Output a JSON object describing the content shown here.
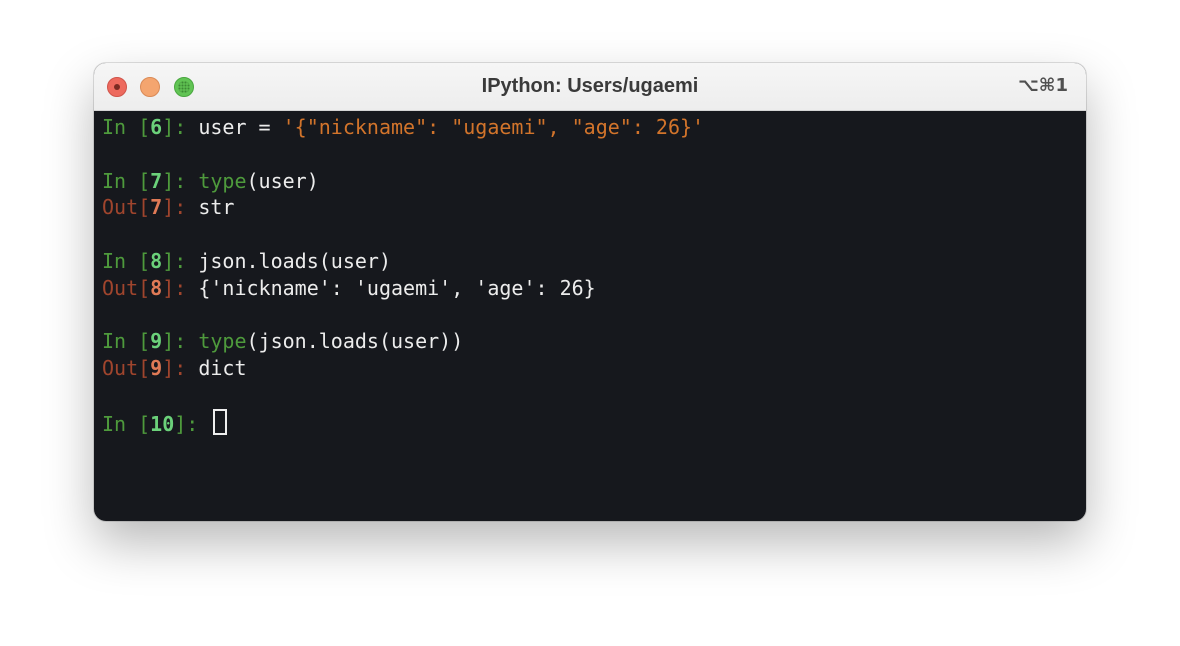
{
  "window": {
    "title": "IPython: Users/ugaemi",
    "shortcut": "⌥⌘1"
  },
  "terminal": {
    "in_label": "In [",
    "out_label": "Out[",
    "prompt_close": "]: ",
    "cells": [
      {
        "in_num": "6",
        "code_pre": "user = ",
        "code_str": "'{\"nickname\": \"ugaemi\", \"age\": 26}'"
      },
      {
        "in_num": "7",
        "builtin": "type",
        "code": "(user)",
        "out_num": "7",
        "out": "str"
      },
      {
        "in_num": "8",
        "code": "json.loads(user)",
        "out_num": "8",
        "out": "{'nickname': 'ugaemi', 'age': 26}"
      },
      {
        "in_num": "9",
        "builtin": "type",
        "code": "(json.loads(user))",
        "out_num": "9",
        "out": "dict"
      },
      {
        "in_num": "10"
      }
    ]
  }
}
